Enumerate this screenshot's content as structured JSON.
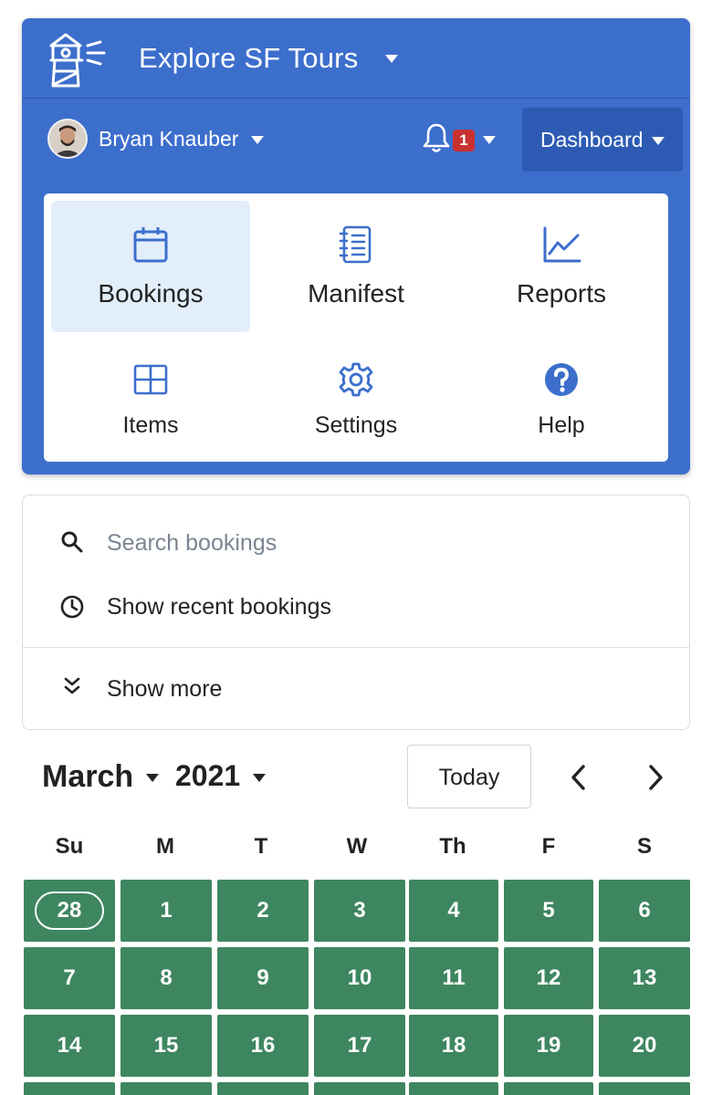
{
  "header": {
    "brand_title": "Explore SF Tours",
    "user_name": "Bryan Knauber",
    "notification_count": "1",
    "dashboard_label": "Dashboard",
    "accent_color": "#3c6ecc"
  },
  "menu": {
    "items": [
      {
        "label": "Bookings",
        "icon": "calendar-icon",
        "active": true
      },
      {
        "label": "Manifest",
        "icon": "notebook-icon"
      },
      {
        "label": "Reports",
        "icon": "line-chart-icon"
      },
      {
        "label": "Items",
        "icon": "grid-icon"
      },
      {
        "label": "Settings",
        "icon": "gear-icon"
      },
      {
        "label": "Help",
        "icon": "question-circle-icon"
      }
    ]
  },
  "search": {
    "placeholder": "Search bookings",
    "recent_label": "Show recent bookings",
    "more_label": "Show more"
  },
  "calendar": {
    "month": "March",
    "year": "2021",
    "today_label": "Today",
    "weekdays": [
      "Su",
      "M",
      "T",
      "W",
      "Th",
      "F",
      "S"
    ],
    "weeks": [
      [
        "28",
        "1",
        "2",
        "3",
        "4",
        "5",
        "6"
      ],
      [
        "7",
        "8",
        "9",
        "10",
        "11",
        "12",
        "13"
      ],
      [
        "14",
        "15",
        "16",
        "17",
        "18",
        "19",
        "20"
      ]
    ],
    "highlighted_day": "28",
    "day_color": "#3e8660"
  }
}
